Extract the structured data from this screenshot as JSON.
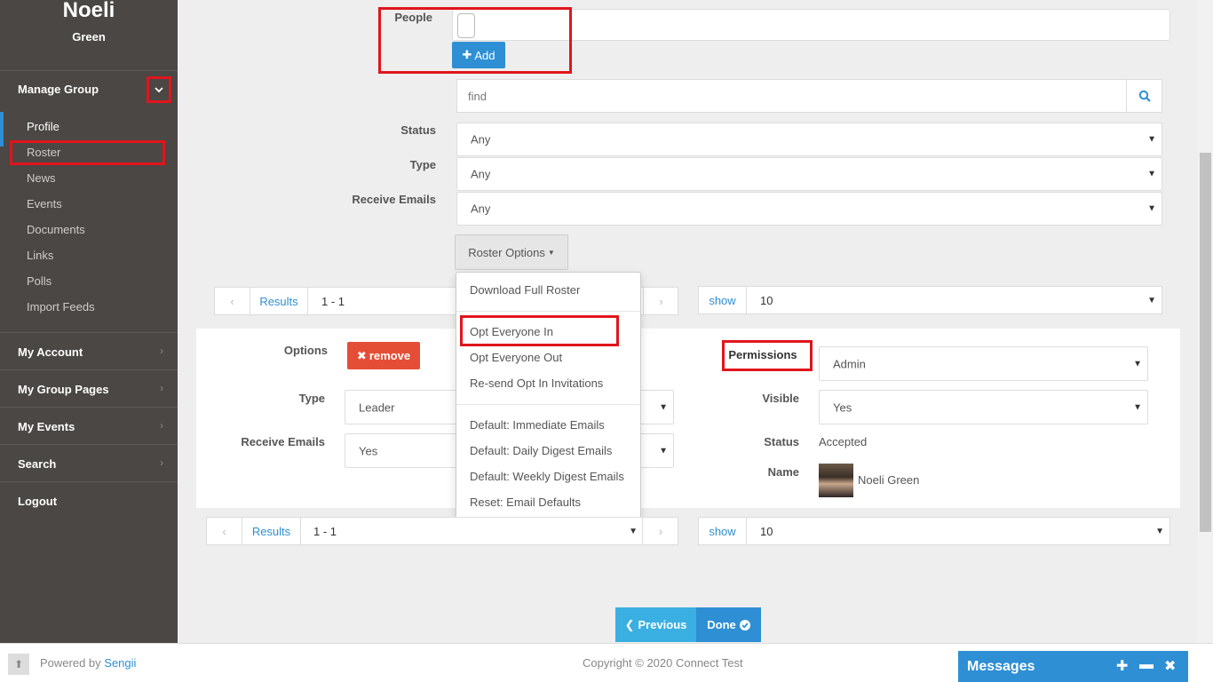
{
  "sidebar": {
    "first_name": "Noeli",
    "last_name": "Green",
    "group_label": "Manage Group",
    "sub_items": [
      "Profile",
      "Roster",
      "News",
      "Events",
      "Documents",
      "Links",
      "Polls",
      "Import Feeds"
    ],
    "main_items": [
      "My Account",
      "My Group Pages",
      "My Events",
      "Search",
      "Logout"
    ]
  },
  "form": {
    "people_label": "People",
    "add_label": "Add",
    "find_placeholder": "find",
    "status_label": "Status",
    "status_value": "Any",
    "type_label": "Type",
    "type_value": "Any",
    "receive_label": "Receive Emails",
    "receive_value": "Any",
    "roster_options_label": "Roster Options"
  },
  "dropdown": {
    "items": [
      "Download Full Roster",
      "Opt Everyone In",
      "Opt Everyone Out",
      "Re-send Opt In Invitations",
      "Default: Immediate Emails",
      "Default: Daily Digest Emails",
      "Default: Weekly Digest Emails",
      "Reset: Email Defaults"
    ]
  },
  "pager": {
    "results_label": "Results",
    "range": "1 - 1",
    "show_label": "show",
    "show_value": "10"
  },
  "member": {
    "options_label": "Options",
    "remove_label": "remove",
    "type_label": "Type",
    "type_value": "Leader",
    "receive_label": "Receive Emails",
    "receive_value": "Yes",
    "permissions_label": "Permissions",
    "permissions_value": "Admin",
    "visible_label": "Visible",
    "visible_value": "Yes",
    "status_label": "Status",
    "status_value": "Accepted",
    "name_label": "Name",
    "name_value": "Noeli Green"
  },
  "nav": {
    "previous_label": "Previous",
    "done_label": "Done"
  },
  "footer": {
    "powered_by": "Powered by",
    "powered_link": "Sengii",
    "copyright": "Copyright © 2020 Connect Test",
    "messages_label": "Messages"
  }
}
